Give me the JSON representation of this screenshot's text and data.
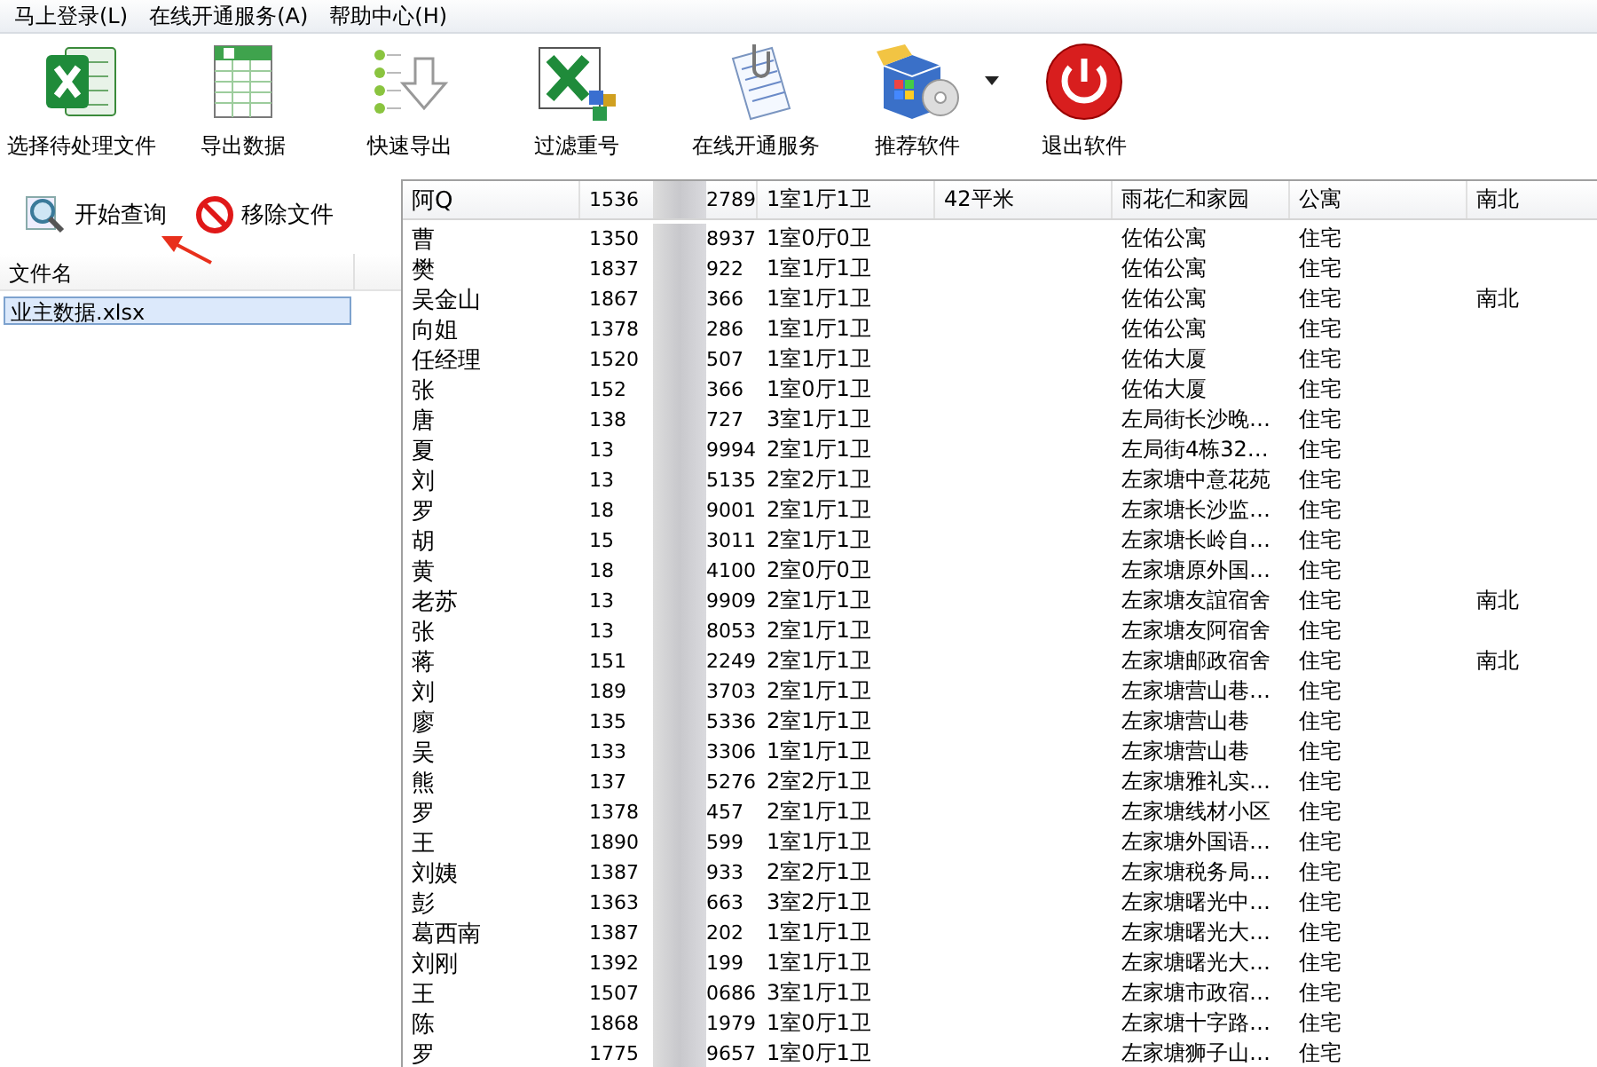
{
  "menu": [
    {
      "label": "马上登录(L)"
    },
    {
      "label": "在线开通服务(A)"
    },
    {
      "label": "帮助中心(H)"
    }
  ],
  "toolbar": [
    {
      "label": "选择待处理文件",
      "dropdown": false
    },
    {
      "label": "导出数据",
      "dropdown": false
    },
    {
      "label": "快速导出",
      "dropdown": false
    },
    {
      "label": "过滤重号",
      "dropdown": false
    },
    {
      "label": "在线开通服务",
      "dropdown": false
    },
    {
      "label": "推荐软件",
      "dropdown": true
    },
    {
      "label": "退出软件",
      "dropdown": false
    }
  ],
  "file_panel": {
    "actions": [
      {
        "label": "开始查询",
        "kind": "search"
      },
      {
        "label": "移除文件",
        "kind": "remove"
      }
    ],
    "column": "文件名",
    "files": [
      {
        "name": "业主数据.xlsx",
        "selected": true
      }
    ]
  },
  "table": {
    "header": [
      "阿Q",
      {
        "head": "1536",
        "tail": "2789"
      },
      "1室1厅1卫",
      "42平米",
      "雨花仁和家园",
      "公寓",
      "南北"
    ],
    "rows": [
      [
        "曹",
        {
          "head": "1350",
          "tail": "8937"
        },
        "1室0厅0卫",
        "",
        "佐佑公寓",
        "住宅",
        ""
      ],
      [
        "樊",
        {
          "head": "1837",
          "tail": "922"
        },
        "1室1厅1卫",
        "",
        "佐佑公寓",
        "住宅",
        ""
      ],
      [
        "吴金山",
        {
          "head": "1867",
          "tail": "366"
        },
        "1室1厅1卫",
        "",
        "佐佑公寓",
        "住宅",
        "南北"
      ],
      [
        "向姐",
        {
          "head": "1378",
          "tail": "286"
        },
        "1室1厅1卫",
        "",
        "佐佑公寓",
        "住宅",
        ""
      ],
      [
        "任经理",
        {
          "head": "1520",
          "tail": "507"
        },
        "1室1厅1卫",
        "",
        "佐佑大厦",
        "住宅",
        ""
      ],
      [
        "张",
        {
          "head": "152",
          "tail": "366"
        },
        "1室0厅1卫",
        "",
        "佐佑大厦",
        "住宅",
        ""
      ],
      [
        "唐",
        {
          "head": "138",
          "tail": "727"
        },
        "3室1厅1卫",
        "",
        "左局街长沙晚…",
        "住宅",
        ""
      ],
      [
        "夏",
        {
          "head": "13",
          "tail": "9994"
        },
        "2室1厅1卫",
        "",
        "左局街4栋32…",
        "住宅",
        ""
      ],
      [
        "刘",
        {
          "head": "13",
          "tail": "5135"
        },
        "2室2厅1卫",
        "",
        "左家塘中意花苑",
        "住宅",
        ""
      ],
      [
        "罗",
        {
          "head": "18",
          "tail": "9001"
        },
        "2室1厅1卫",
        "",
        "左家塘长沙监…",
        "住宅",
        ""
      ],
      [
        "胡",
        {
          "head": "15",
          "tail": "3011"
        },
        "2室1厅1卫",
        "",
        "左家塘长岭自…",
        "住宅",
        ""
      ],
      [
        "黄",
        {
          "head": "18",
          "tail": "4100"
        },
        "2室0厅0卫",
        "",
        "左家塘原外国…",
        "住宅",
        ""
      ],
      [
        "老苏",
        {
          "head": "13",
          "tail": "9909"
        },
        "2室1厅1卫",
        "",
        "左家塘友誼宿舍",
        "住宅",
        "南北"
      ],
      [
        "张",
        {
          "head": "13",
          "tail": "8053"
        },
        "2室1厅1卫",
        "",
        "左家塘友阿宿舍",
        "住宅",
        ""
      ],
      [
        "蒋",
        {
          "head": "151",
          "tail": "2249"
        },
        "2室1厅1卫",
        "",
        "左家塘邮政宿舍",
        "住宅",
        "南北"
      ],
      [
        "刘",
        {
          "head": "189",
          "tail": "3703"
        },
        "2室1厅1卫",
        "",
        "左家塘营山巷…",
        "住宅",
        ""
      ],
      [
        "廖",
        {
          "head": "135",
          "tail": "5336"
        },
        "2室1厅1卫",
        "",
        "左家塘营山巷",
        "住宅",
        ""
      ],
      [
        "吴",
        {
          "head": "133",
          "tail": "3306"
        },
        "1室1厅1卫",
        "",
        "左家塘营山巷",
        "住宅",
        ""
      ],
      [
        "熊",
        {
          "head": "137",
          "tail": "5276"
        },
        "2室2厅1卫",
        "",
        "左家塘雅礼实…",
        "住宅",
        ""
      ],
      [
        "罗",
        {
          "head": "1378",
          "tail": "457"
        },
        "2室1厅1卫",
        "",
        "左家塘线材小区",
        "住宅",
        ""
      ],
      [
        "王",
        {
          "head": "1890",
          "tail": "599"
        },
        "1室1厅1卫",
        "",
        "左家塘外国语…",
        "住宅",
        ""
      ],
      [
        "刘姨",
        {
          "head": "1387",
          "tail": "933"
        },
        "2室2厅1卫",
        "",
        "左家塘税务局…",
        "住宅",
        ""
      ],
      [
        "彭",
        {
          "head": "1363",
          "tail": "663"
        },
        "3室2厅1卫",
        "",
        "左家塘曙光中…",
        "住宅",
        ""
      ],
      [
        "葛西南",
        {
          "head": "1387",
          "tail": "202"
        },
        "1室1厅1卫",
        "",
        "左家塘曙光大…",
        "住宅",
        ""
      ],
      [
        "刘刚",
        {
          "head": "1392",
          "tail": "199"
        },
        "1室1厅1卫",
        "",
        "左家塘曙光大…",
        "住宅",
        ""
      ],
      [
        "王",
        {
          "head": "1507",
          "tail": "0686"
        },
        "3室1厅1卫",
        "",
        "左家塘市政宿…",
        "住宅",
        ""
      ],
      [
        "陈",
        {
          "head": "1868",
          "tail": "1979"
        },
        "1室0厅1卫",
        "",
        "左家塘十字路…",
        "住宅",
        ""
      ],
      [
        "罗",
        {
          "head": "1775",
          "tail": "9657"
        },
        "1室0厅1卫",
        "",
        "左家塘狮子山…",
        "住宅",
        ""
      ]
    ]
  }
}
